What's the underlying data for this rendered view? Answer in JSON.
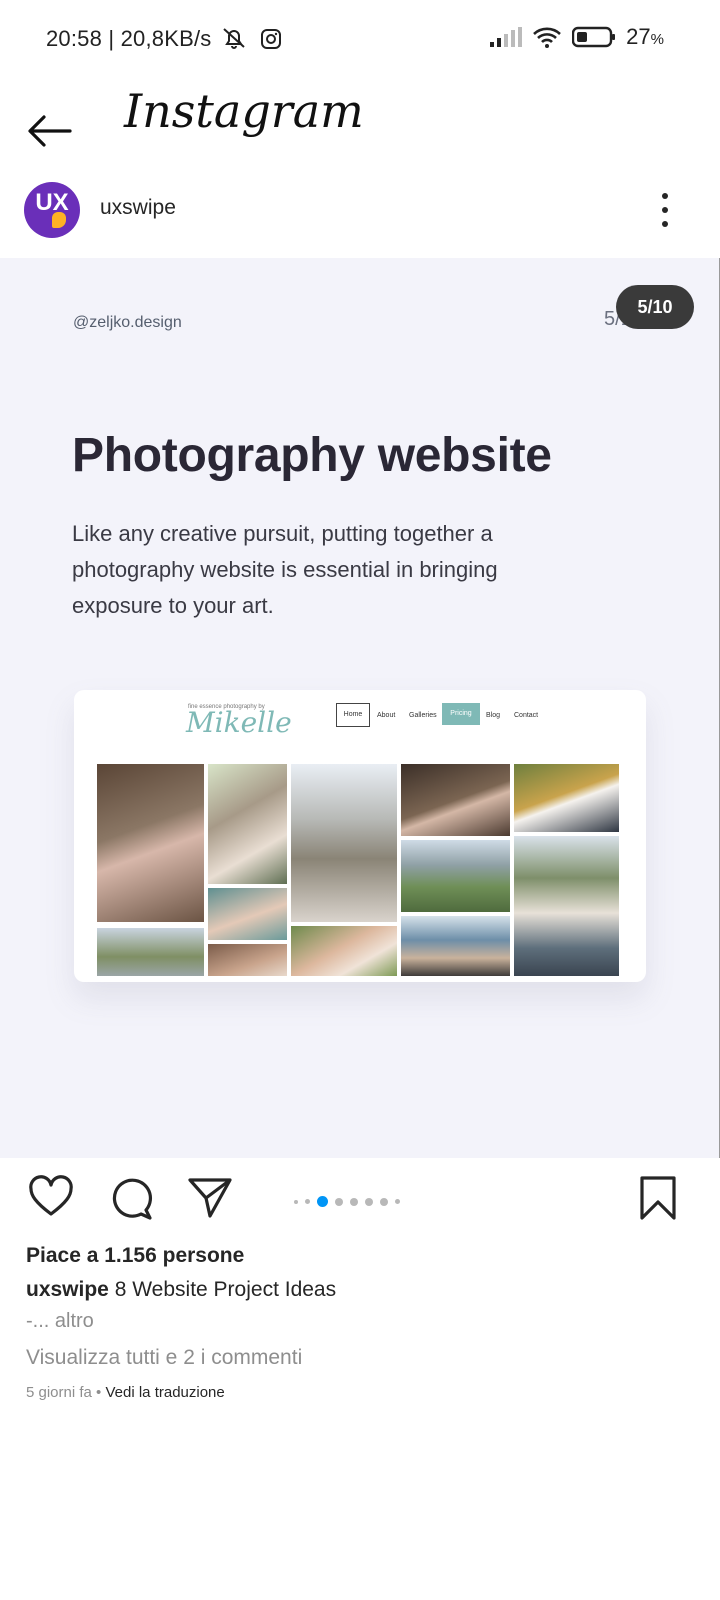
{
  "status_bar": {
    "time_speed": "20:58 | 20,8KB/s",
    "battery_percent": "27",
    "battery_unit": "%",
    "icons": [
      "mute-bell-icon",
      "instagram-icon",
      "signal-icon",
      "wifi-icon",
      "battery-icon"
    ]
  },
  "app_bar": {
    "title": "Instagram",
    "back_icon": "arrow-left-icon"
  },
  "post": {
    "username": "uxswipe",
    "avatar_text": "UX",
    "more_icon": "vertical-ellipsis-icon",
    "counter": "5/10",
    "slide": {
      "handle": "@zeljko.design",
      "page_indicator": "5/10",
      "headline": "Photography website",
      "description": "Like any creative pursuit, putting together a photography website is essential in bringing exposure to your art.",
      "mockup": {
        "tagline": "fine essence photography by",
        "brand": "Mikelle",
        "nav": [
          "Home",
          "About",
          "Galleries",
          "Pricing",
          "Blog",
          "Contact"
        ],
        "active_nav": "Pricing"
      }
    },
    "carousel": {
      "current": 5,
      "total": 10
    },
    "likes": "Piace a 1.156 persone",
    "caption_user": "uxswipe",
    "caption_text": "8 Website Project Ideas",
    "caption_more": "-... altro",
    "comments_link": "Visualizza tutti e 2 i commenti",
    "time_ago": "5 giorni fa",
    "separator": "•",
    "translate_link": "Vedi la traduzione"
  },
  "colors": {
    "accent_blue": "#0095f6",
    "slide_background": "#f3f3fa",
    "avatar_purple": "#6a2fb9",
    "brand_teal": "#7fb9b6"
  }
}
